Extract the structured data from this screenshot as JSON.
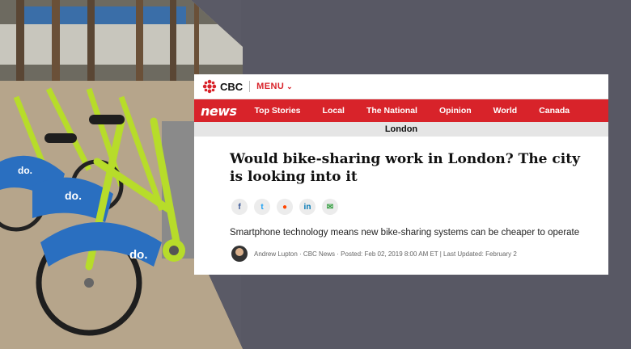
{
  "site": {
    "brand": "CBC",
    "menu_label": "MENU",
    "section_logo": "news"
  },
  "nav": {
    "items": [
      "Top Stories",
      "Local",
      "The National",
      "Opinion",
      "World",
      "Canada"
    ]
  },
  "subnav": {
    "region": "London"
  },
  "article": {
    "headline": "Would bike-sharing work in London? The city is looking into it",
    "dek": "Smartphone technology means new bike-sharing systems can be cheaper to operate",
    "byline": "Andrew Lupton · CBC News · Posted: Feb 02, 2019 8:00 AM ET | Last Updated: February 2"
  },
  "share_icons": [
    {
      "icon": "facebook-icon",
      "glyph": "f",
      "color": "#3b5998"
    },
    {
      "icon": "twitter-icon",
      "glyph": "t",
      "color": "#1da1f2"
    },
    {
      "icon": "reddit-icon",
      "glyph": "●",
      "color": "#ff4500"
    },
    {
      "icon": "linkedin-icon",
      "glyph": "in",
      "color": "#0077b5"
    },
    {
      "icon": "email-icon",
      "glyph": "✉",
      "color": "#2e9c3b"
    }
  ],
  "photo": {
    "bike_text": "do."
  },
  "colors": {
    "cbc_red": "#d8232a",
    "bike_lime": "#b7dc2a",
    "bike_blue": "#2a6fc0",
    "background": "#585864"
  }
}
